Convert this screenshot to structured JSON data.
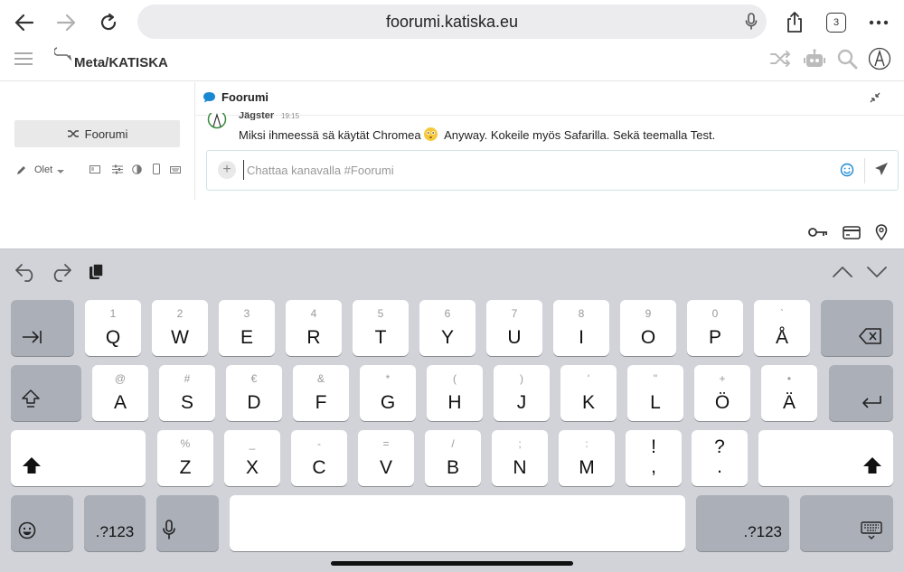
{
  "browser": {
    "url": "foorumi.katiska.eu",
    "tab_count": "3"
  },
  "header": {
    "brand": "Meta/KATISKA"
  },
  "sidebar": {
    "button_label": "Foorumi",
    "status_label": "Olet"
  },
  "chat": {
    "channel_title": "Foorumi",
    "message": {
      "user": "Jägster",
      "time": "19:15",
      "text_before": "Miksi ihmeessä sä käytät Chromea",
      "text_after": "Anyway. Kokeile myös Safarilla. Sekä teemalla Test."
    },
    "composer_placeholder": "Chattaa kanavalla #Foorumi"
  },
  "keyboard": {
    "row1": [
      {
        "hint": "1",
        "key": "Q"
      },
      {
        "hint": "2",
        "key": "W"
      },
      {
        "hint": "3",
        "key": "E"
      },
      {
        "hint": "4",
        "key": "R"
      },
      {
        "hint": "5",
        "key": "T"
      },
      {
        "hint": "6",
        "key": "Y"
      },
      {
        "hint": "7",
        "key": "U"
      },
      {
        "hint": "8",
        "key": "I"
      },
      {
        "hint": "9",
        "key": "O"
      },
      {
        "hint": "0",
        "key": "P"
      },
      {
        "hint": "`",
        "key": "Å"
      }
    ],
    "row2": [
      {
        "hint": "@",
        "key": "A"
      },
      {
        "hint": "#",
        "key": "S"
      },
      {
        "hint": "€",
        "key": "D"
      },
      {
        "hint": "&",
        "key": "F"
      },
      {
        "hint": "*",
        "key": "G"
      },
      {
        "hint": "(",
        "key": "H"
      },
      {
        "hint": ")",
        "key": "J"
      },
      {
        "hint": "'",
        "key": "K"
      },
      {
        "hint": "\"",
        "key": "L"
      },
      {
        "hint": "+",
        "key": "Ö"
      },
      {
        "hint": "•",
        "key": "Ä"
      }
    ],
    "row3": [
      {
        "hint": "%",
        "key": "Z"
      },
      {
        "hint": "_",
        "key": "X"
      },
      {
        "hint": "-",
        "key": "C"
      },
      {
        "hint": "=",
        "key": "V"
      },
      {
        "hint": "/",
        "key": "B"
      },
      {
        "hint": ";",
        "key": "N"
      },
      {
        "hint": ":",
        "key": "M"
      }
    ],
    "punct1": {
      "top": "!",
      "bottom": ","
    },
    "punct2": {
      "top": "?",
      "bottom": "."
    },
    "numbers_label": ".?123"
  }
}
